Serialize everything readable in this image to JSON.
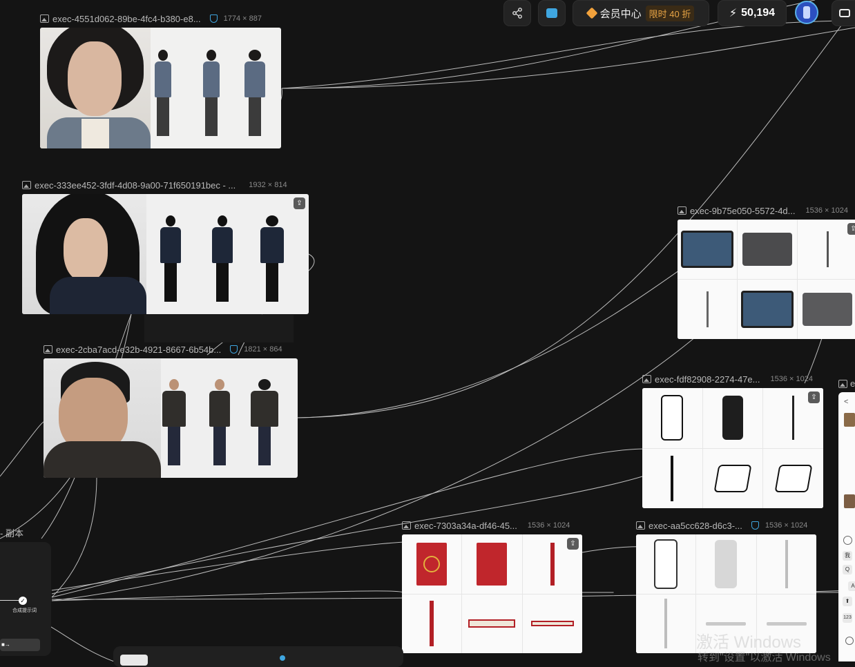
{
  "topbar": {
    "vip_label": "会员中心",
    "discount_label": "限时 40 折",
    "credits": "50,194"
  },
  "nodes": [
    {
      "title": "exec-4551d062-89be-4fc4-b380-e8...",
      "dims": "1774 × 887"
    },
    {
      "title": "exec-333ee452-3fdf-4d08-9a00-71f650191bec - ...",
      "dims": "1932 × 814"
    },
    {
      "title": "exec-2cba7acd-e32b-4921-8667-6b54b...",
      "dims": "1821 × 864"
    },
    {
      "title": "exec-9b75e050-5572-4d...",
      "dims": "1536 × 1024"
    },
    {
      "title": "exec-fdf82908-2274-47e...",
      "dims": "1536 × 1024"
    },
    {
      "title": "exec-7303a34a-df46-45...",
      "dims": "1536 × 1024"
    },
    {
      "title": "exec-aa5cc628-d6c3-...",
      "dims": "1536 × 1024"
    }
  ],
  "partial_node_title": "e",
  "left_panel": {
    "label": "- 副本",
    "small_node_label": "合成提示词",
    "button_label": "■→"
  },
  "side_panel_keys": [
    "<",
    "我",
    "Q",
    "A",
    "123"
  ],
  "watermark": {
    "line1": "激活 Windows",
    "line2": "转到\"设置\"以激活 Windows"
  },
  "colors": {
    "background": "#141414",
    "accent_blue": "#3fa6e0",
    "discount_orange": "#e7a445",
    "passport_red": "#c0262c"
  }
}
